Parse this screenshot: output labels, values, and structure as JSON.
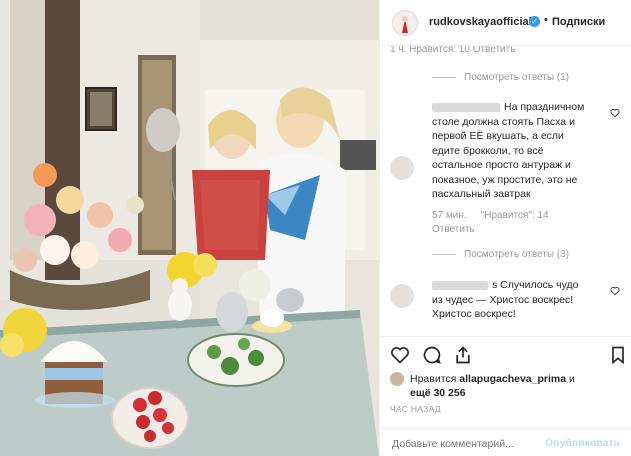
{
  "post": {
    "username": "rudkovskayaofficial",
    "separator": "•",
    "follow_label": "Подписки"
  },
  "comments": {
    "truncated_meta": "1 ч.       Нравится: 10    Ответить",
    "items": [
      {
        "view_replies": "Посмотреть ответы (1)"
      },
      {
        "text": "На праздничном столе должна стоять Пасха и первой ЕЁ вкушать, а если едите брокколи, то всё остальное просто антураж и показное, уж простите, это не пасхальный завтрак",
        "time": "57 мин.",
        "likes": "\"Нравится\": 14",
        "reply": "Ответить",
        "view_replies": "Посмотреть ответы (3)"
      },
      {
        "text_suffix": "s Случилось чудо из чудес — Христос воскрес! Христос воскрес!"
      }
    ]
  },
  "likes": {
    "prefix": "Нравится",
    "user": "allapugacheva_prima",
    "and": "и",
    "others": "ещё 30 256"
  },
  "time_ago": "ЧАС НАЗАД",
  "comment_box": {
    "placeholder": "Добавьте комментарий...",
    "publish": "Опубликовать"
  }
}
